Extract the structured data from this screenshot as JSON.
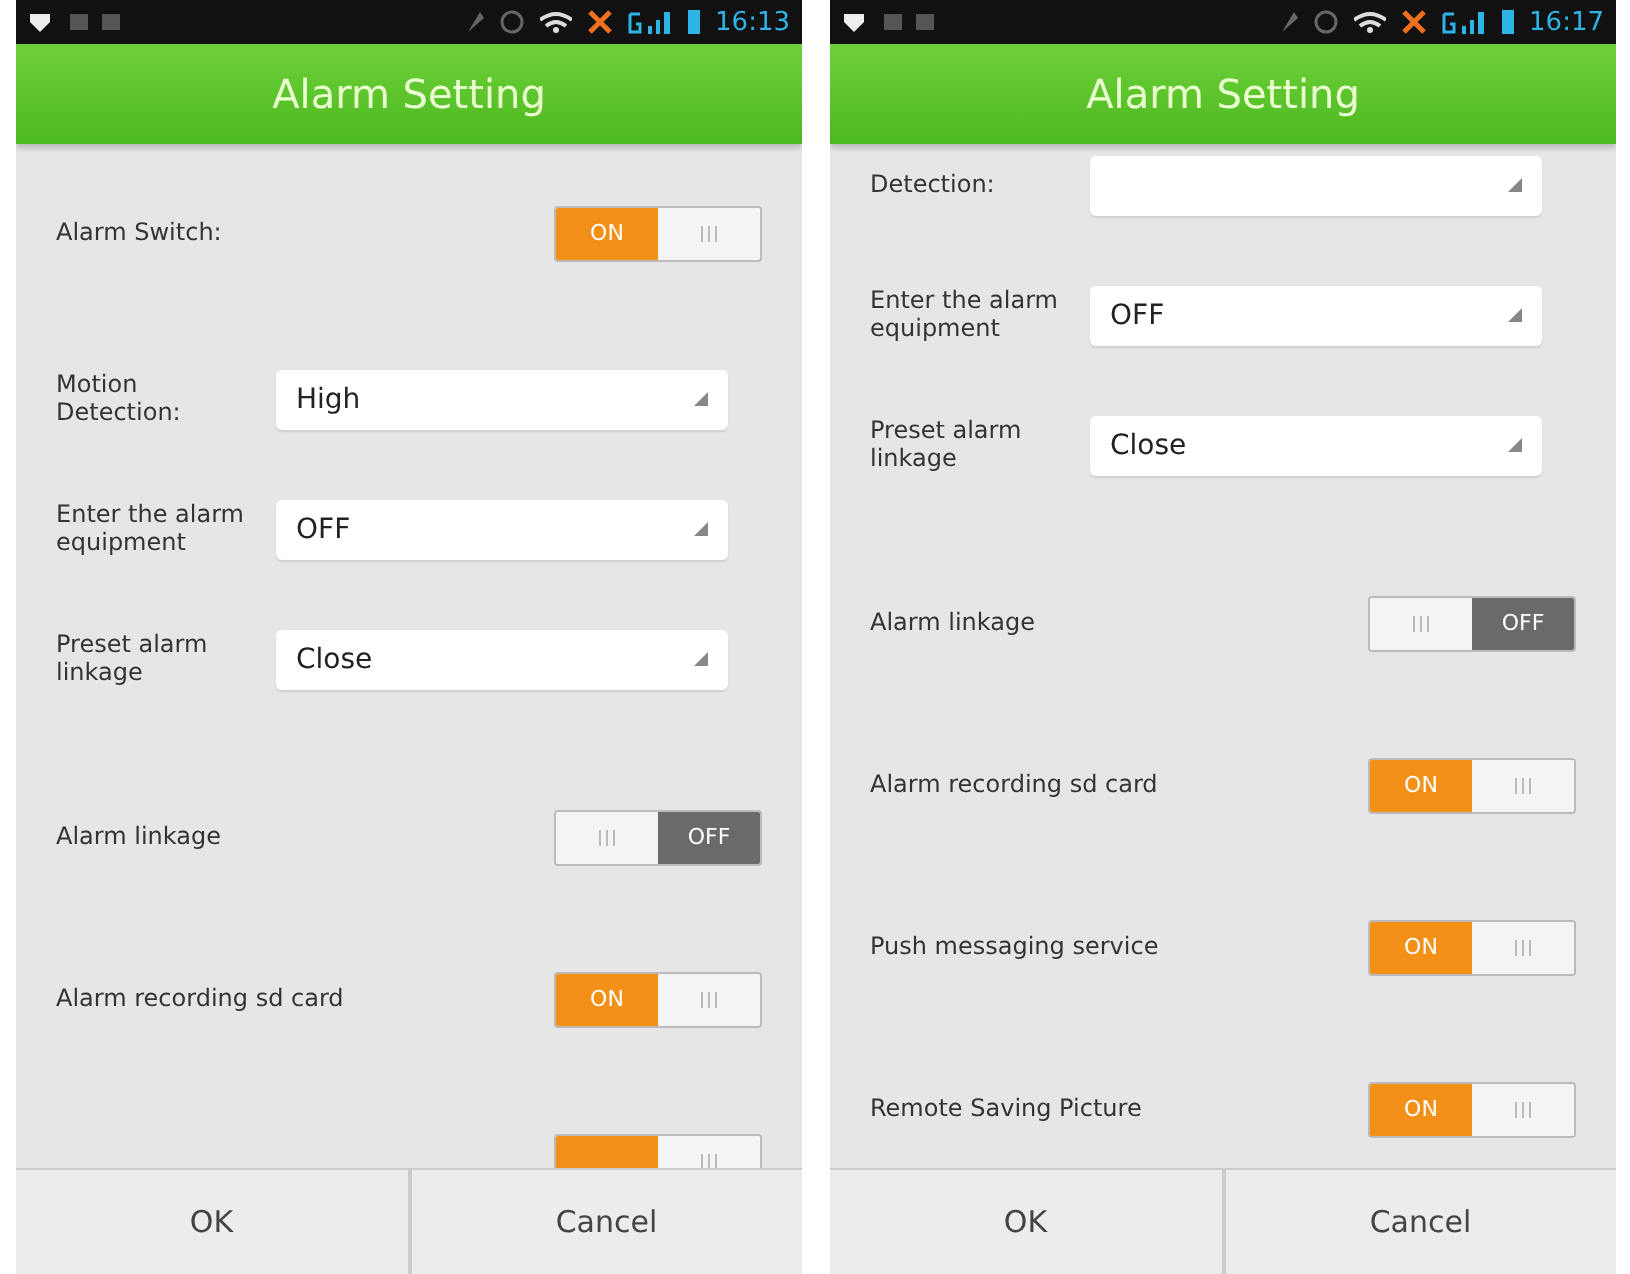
{
  "screens": [
    {
      "status_bar": {
        "time": "16:13"
      },
      "title": "Alarm Setting",
      "scrolled": false,
      "rows": [
        {
          "kind": "toggle",
          "label": "Alarm Switch:",
          "on": true,
          "state_text": "ON"
        },
        {
          "kind": "select",
          "label": "Motion Detection:",
          "value": "High"
        },
        {
          "kind": "select",
          "label": "Enter the alarm equipment",
          "value": "OFF"
        },
        {
          "kind": "select",
          "label": "Preset alarm linkage",
          "value": "Close"
        },
        {
          "kind": "toggle",
          "label": "Alarm linkage",
          "on": false,
          "state_text": "OFF"
        },
        {
          "kind": "toggle",
          "label": "Alarm recording sd card",
          "on": true,
          "state_text": "ON"
        },
        {
          "kind": "toggle",
          "on": true
        }
      ],
      "buttons": [
        "OK",
        "Cancel"
      ]
    },
    {
      "status_bar": {
        "time": "16:17"
      },
      "title": "Alarm Setting",
      "scrolled": true,
      "rows": [
        {
          "kind": "select",
          "label": "Detection:"
        },
        {
          "kind": "select",
          "label": "Enter the alarm equipment",
          "value": "OFF"
        },
        {
          "kind": "select",
          "label": "Preset alarm linkage",
          "value": "Close"
        },
        {
          "kind": "toggle",
          "label": "Alarm linkage",
          "on": false,
          "state_text": "OFF"
        },
        {
          "kind": "toggle",
          "label": "Alarm recording sd card",
          "on": true,
          "state_text": "ON"
        },
        {
          "kind": "toggle",
          "label": "Push messaging service",
          "on": true,
          "state_text": "ON"
        },
        {
          "kind": "toggle",
          "label": "Remote Saving Picture",
          "on": true,
          "state_text": "ON"
        }
      ],
      "buttons": [
        "OK",
        "Cancel"
      ]
    }
  ]
}
